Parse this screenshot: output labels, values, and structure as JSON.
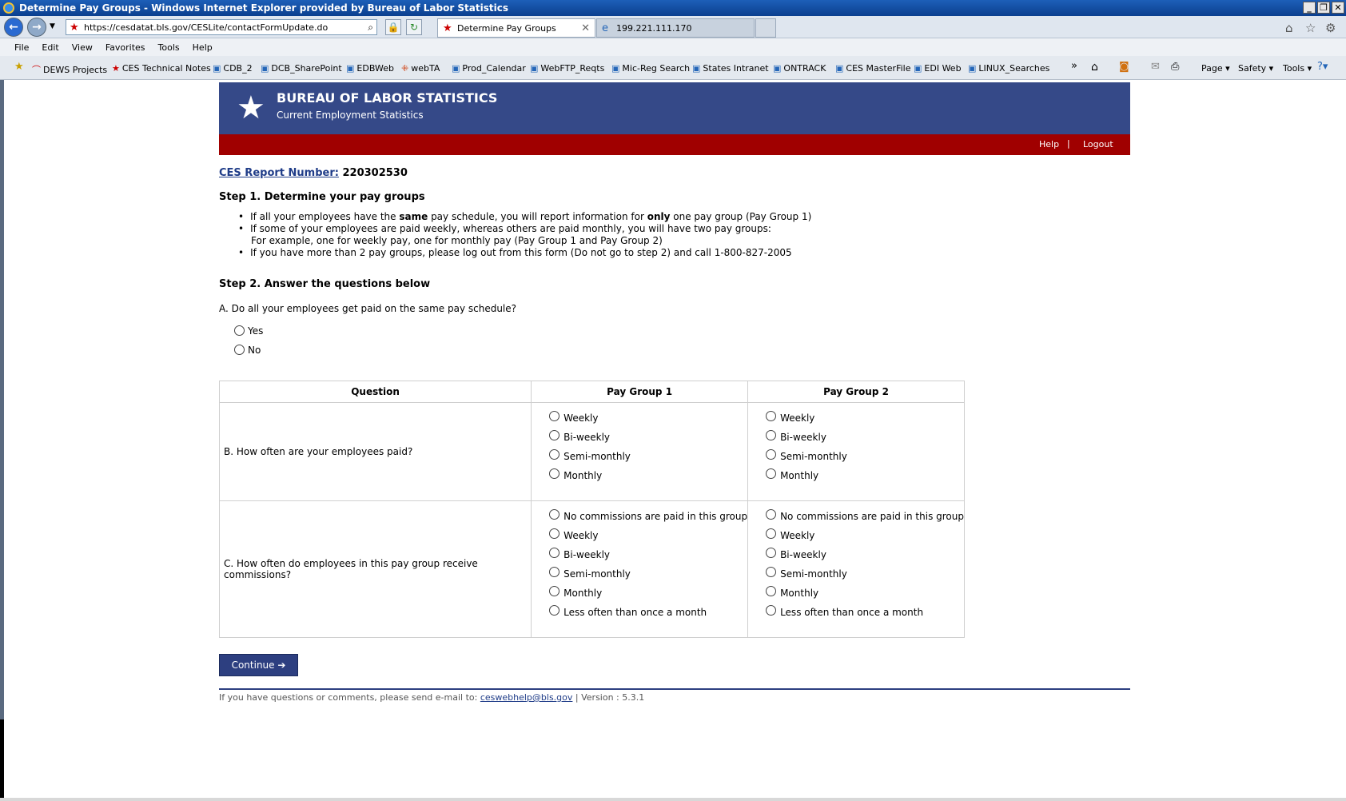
{
  "window": {
    "title": "Determine Pay Groups - Windows Internet Explorer provided by Bureau of Labor Statistics"
  },
  "browser": {
    "url": "https://cesdatat.bls.gov/CESLite/contactFormUpdate.do",
    "tabs": [
      {
        "label": "Determine Pay Groups"
      },
      {
        "label": "199.221.111.170"
      }
    ],
    "menu": [
      "File",
      "Edit",
      "View",
      "Favorites",
      "Tools",
      "Help"
    ],
    "favorites": [
      "DEWS Projects",
      "CES Technical Notes",
      "CDB_2",
      "DCB_SharePoint",
      "EDBWeb",
      "webTA",
      "Prod_Calendar",
      "WebFTP_Reqts",
      "Mic-Reg Search",
      "States Intranet",
      "ONTRACK",
      "CES MasterFile",
      "EDI Web",
      "LINUX_Searches"
    ],
    "commands": [
      "Page",
      "Safety",
      "Tools"
    ]
  },
  "header": {
    "org": "BUREAU OF LABOR STATISTICS",
    "subtitle": "Current Employment Statistics",
    "help": "Help",
    "separator": "|",
    "logout": "Logout"
  },
  "report": {
    "label": "CES Report Number:",
    "number": "220302530"
  },
  "step1": {
    "heading": "Step 1. Determine your pay groups",
    "bullet1_pre": "If all your employees have the ",
    "bullet1_bold1": "same",
    "bullet1_mid": " pay schedule, you will report information for ",
    "bullet1_bold2": "only",
    "bullet1_post": " one pay group (Pay Group 1)",
    "bullet2": "If some of your employees are paid weekly, whereas others are paid monthly, you will have two pay groups:",
    "bullet2_example": "For example, one for weekly pay, one for monthly pay (Pay Group 1 and Pay Group 2)",
    "bullet3": "If you have more than 2 pay groups, please log out from this form (Do not go to step 2) and call 1-800-827-2005"
  },
  "step2": {
    "heading": "Step 2. Answer the questions below",
    "questionA": "A. Do all your employees get paid on the same pay schedule?",
    "answerYes": "Yes",
    "answerNo": "No"
  },
  "table": {
    "headers": {
      "question": "Question",
      "group1": "Pay Group 1",
      "group2": "Pay Group 2"
    },
    "questionB": "B. How often are your employees paid?",
    "optionsB": [
      "Weekly",
      "Bi-weekly",
      "Semi-monthly",
      "Monthly"
    ],
    "questionC": "C. How often do employees in this pay group receive commissions?",
    "optionsC": [
      "No commissions are paid in this group",
      "Weekly",
      "Bi-weekly",
      "Semi-monthly",
      "Monthly",
      "Less often than once a month"
    ]
  },
  "continue": "Continue ➔",
  "footer": {
    "text": "If you have questions or comments, please send e-mail to: ",
    "email": "ceswebhelp@bls.gov",
    "version": " | Version : 5.3.1"
  },
  "colors": {
    "header_blue": "#354988",
    "red_bar": "#a00000",
    "button_blue": "#2d3f80"
  }
}
